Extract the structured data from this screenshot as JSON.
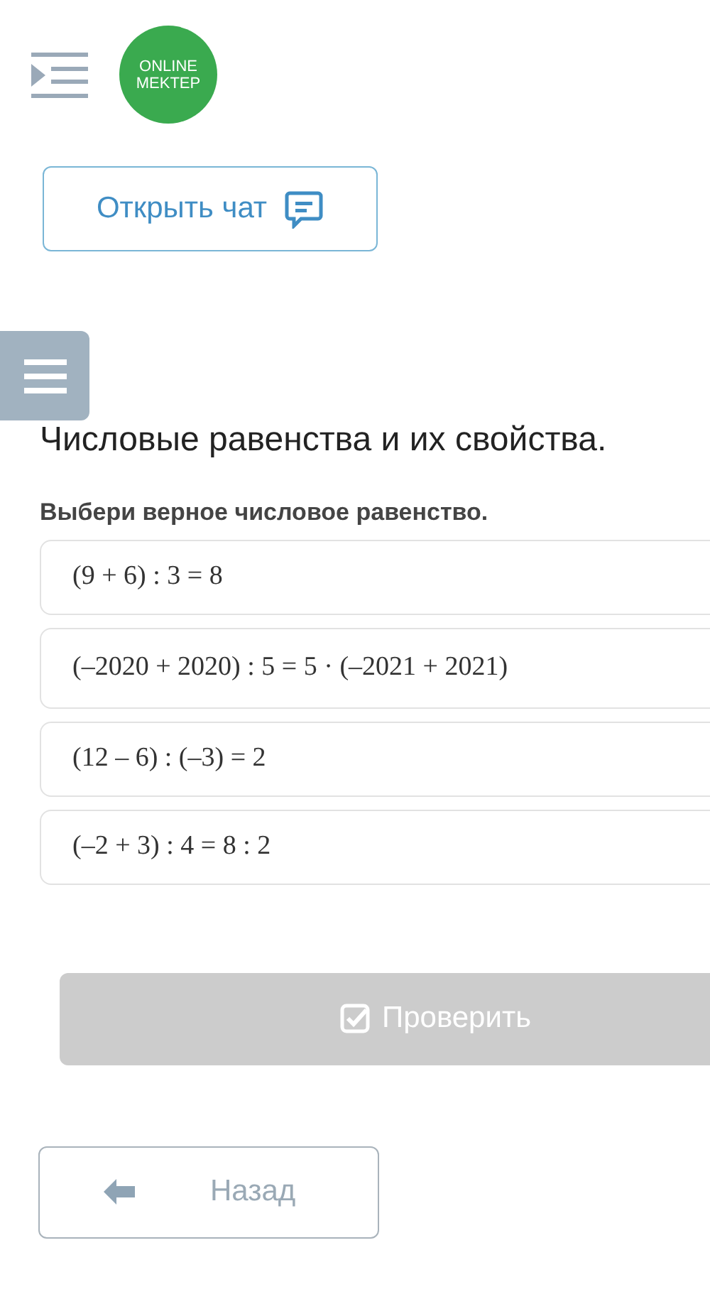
{
  "header": {
    "logo": {
      "lines": [
        "ONLINE",
        "MEKTEP"
      ]
    }
  },
  "chat_button": {
    "label": "Открыть чат"
  },
  "lesson": {
    "title": "Числовые равенства и их свойства.",
    "question": "Выбери верное числовое равенство."
  },
  "options": [
    {
      "text": "(9 + 6) : 3 = 8",
      "selected": false
    },
    {
      "text": "(–2020 + 2020) : 5 = 5 · (–2021 + 2021)",
      "selected": false
    },
    {
      "text": "(12 – 6) : (–3) = 2",
      "selected": false
    },
    {
      "text": "(–2 + 3) : 4 = 8 : 2",
      "selected": false
    }
  ],
  "check_button": {
    "label": "Проверить",
    "disabled": true
  },
  "back_button": {
    "label": "Назад"
  }
}
